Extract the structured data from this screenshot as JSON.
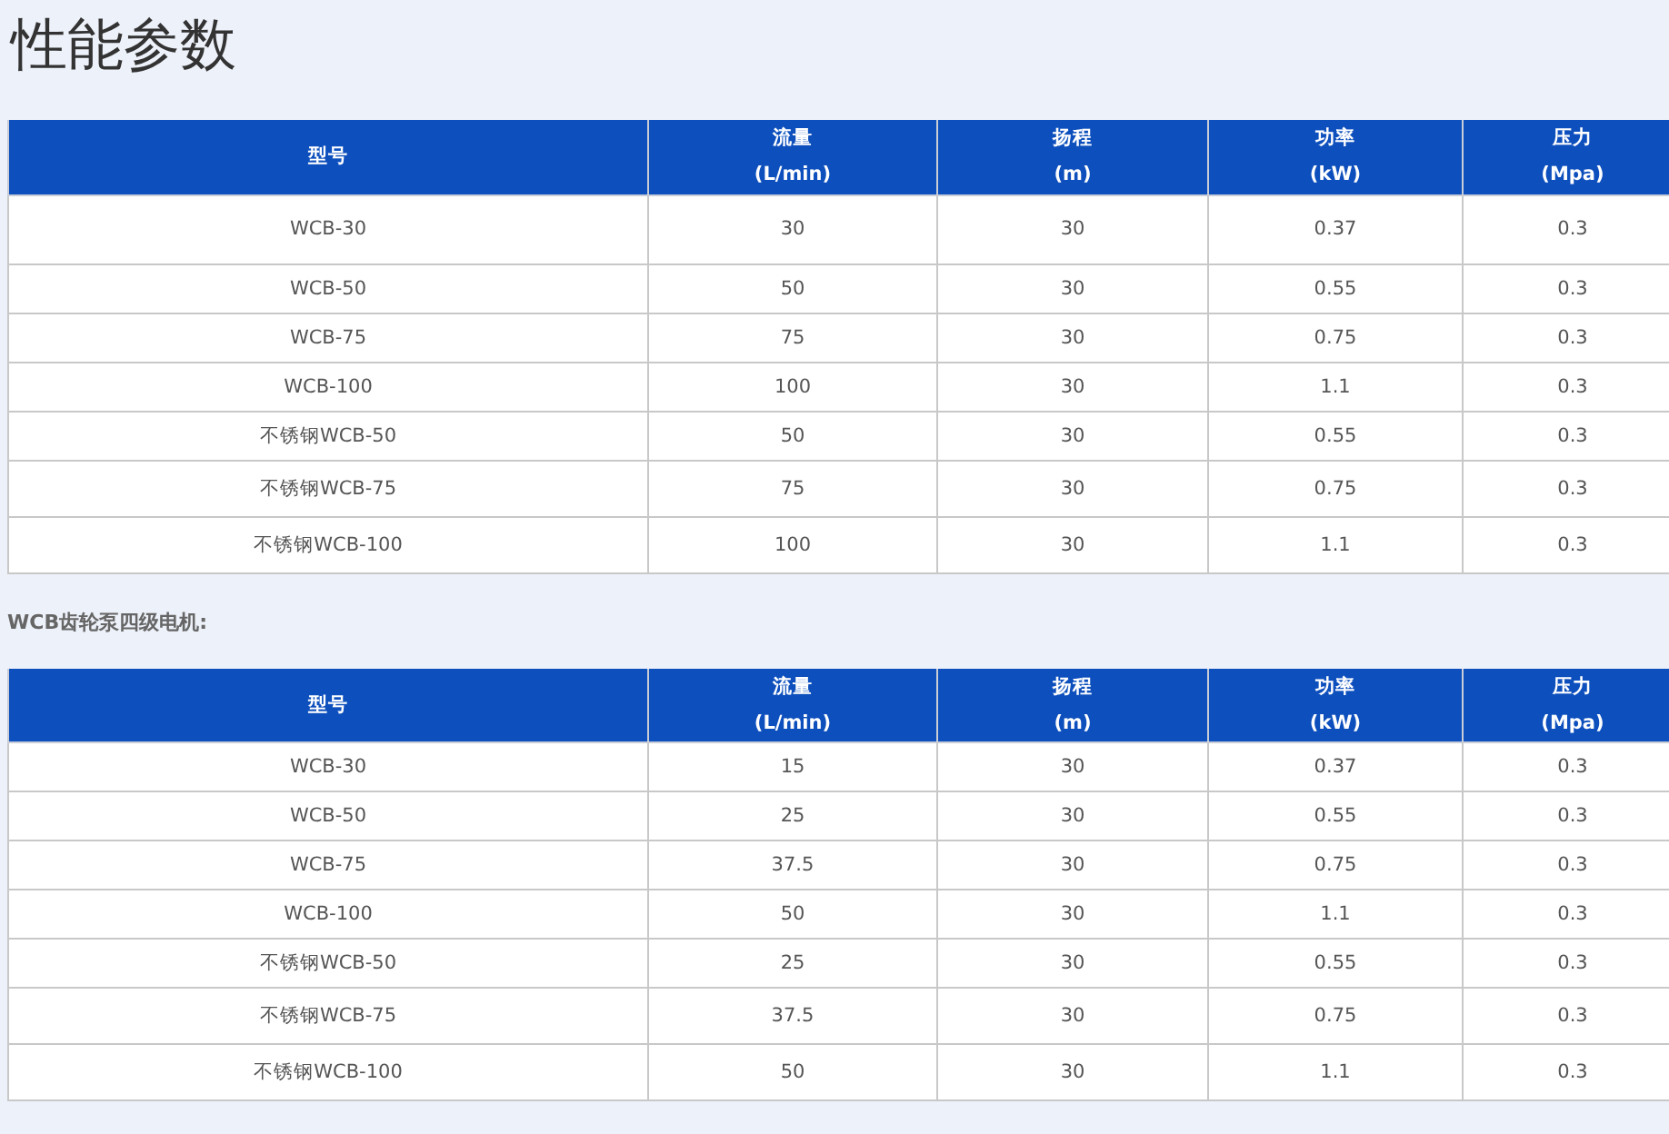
{
  "title": "性能参数",
  "sections": [
    {
      "table": {
        "columns": [
          {
            "name": "型号"
          },
          {
            "name": "流量",
            "unit": "(L/min)"
          },
          {
            "name": "扬程",
            "unit": "(m)"
          },
          {
            "name": "功率",
            "unit": "(kW)"
          },
          {
            "name": "压力",
            "unit": "(Mpa)"
          }
        ],
        "rows": [
          [
            "WCB-30",
            "30",
            "30",
            "0.37",
            "0.3"
          ],
          [
            "WCB-50",
            "50",
            "30",
            "0.55",
            "0.3"
          ],
          [
            "WCB-75",
            "75",
            "30",
            "0.75",
            "0.3"
          ],
          [
            "WCB-100",
            "100",
            "30",
            "1.1",
            "0.3"
          ],
          [
            "不锈钢WCB-50",
            "50",
            "30",
            "0.55",
            "0.3"
          ],
          [
            "不锈钢WCB-75",
            "75",
            "30",
            "0.75",
            "0.3"
          ],
          [
            "不锈钢WCB-100",
            "100",
            "30",
            "1.1",
            "0.3"
          ]
        ]
      }
    },
    {
      "heading": "WCB齿轮泵四级电机:",
      "table": {
        "columns": [
          {
            "name": "型号"
          },
          {
            "name": "流量",
            "unit": "(L/min)"
          },
          {
            "name": "扬程",
            "unit": "(m)"
          },
          {
            "name": "功率",
            "unit": "(kW)"
          },
          {
            "name": "压力",
            "unit": "(Mpa)"
          }
        ],
        "rows": [
          [
            "WCB-30",
            "15",
            "30",
            "0.37",
            "0.3"
          ],
          [
            "WCB-50",
            "25",
            "30",
            "0.55",
            "0.3"
          ],
          [
            "WCB-75",
            "37.5",
            "30",
            "0.75",
            "0.3"
          ],
          [
            "WCB-100",
            "50",
            "30",
            "1.1",
            "0.3"
          ],
          [
            "不锈钢WCB-50",
            "25",
            "30",
            "0.55",
            "0.3"
          ],
          [
            "不锈钢WCB-75",
            "37.5",
            "30",
            "0.75",
            "0.3"
          ],
          [
            "不锈钢WCB-100",
            "50",
            "30",
            "1.1",
            "0.3"
          ]
        ]
      }
    }
  ]
}
